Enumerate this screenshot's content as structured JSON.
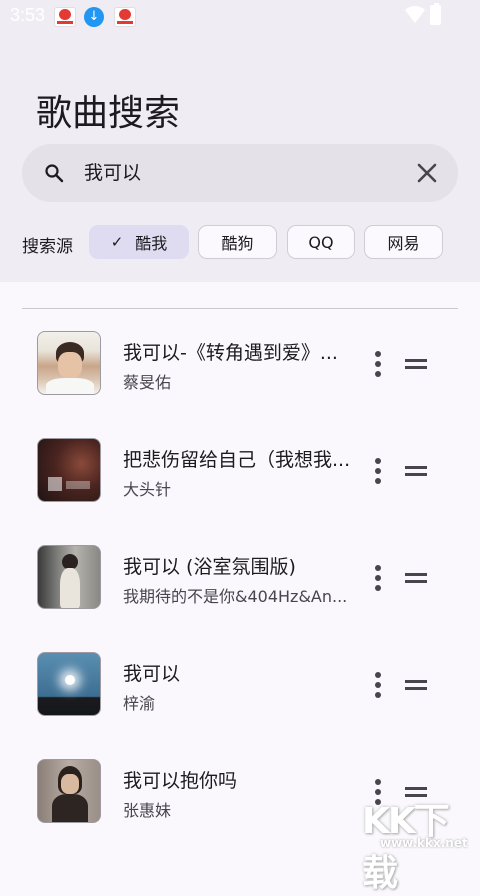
{
  "status_bar": {
    "time": "3:53"
  },
  "page": {
    "title": "歌曲搜索"
  },
  "search": {
    "value": "我可以"
  },
  "sources": {
    "label": "搜索源",
    "chips": [
      {
        "label": "酷我",
        "selected": true
      },
      {
        "label": "酷狗",
        "selected": false
      },
      {
        "label": "QQ",
        "selected": false
      },
      {
        "label": "网易",
        "selected": false
      }
    ]
  },
  "results": [
    {
      "title": "我可以-《转角遇到爱》...",
      "artist": "蔡旻佑"
    },
    {
      "title": "把悲伤留给自己（我想我...",
      "artist": "大头针"
    },
    {
      "title": "我可以 (浴室氛围版)",
      "artist": "我期待的不是你&404Hz&An..."
    },
    {
      "title": "我可以",
      "artist": "梓渝"
    },
    {
      "title": "我可以抱你吗",
      "artist": "张惠妹"
    }
  ],
  "icons": {
    "search": "search-icon",
    "clear": "close-icon",
    "check": "check-icon",
    "more": "more-vert-icon",
    "drag": "drag-handle-icon"
  },
  "colors": {
    "header_bg": "#efedf3",
    "search_bg": "#e4e1e9",
    "chip_selected": "#dfdcf2",
    "body_bg": "#faf8fd"
  },
  "watermark": {
    "text": "KK下载",
    "url": "www.kkx.net"
  }
}
